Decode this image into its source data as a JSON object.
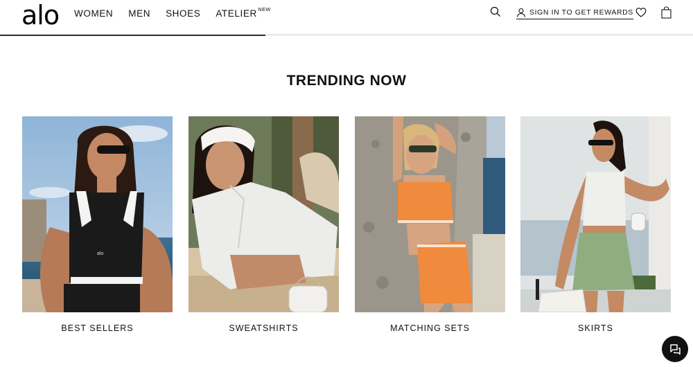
{
  "header": {
    "logo": "alo",
    "nav": [
      {
        "label": "WOMEN"
      },
      {
        "label": "MEN"
      },
      {
        "label": "SHOES"
      },
      {
        "label": "ATELIER",
        "badge": "NEW"
      }
    ],
    "signin_label": "SIGN IN TO GET REWARDS",
    "icons": [
      "search-icon",
      "user-icon",
      "heart-icon",
      "bag-icon"
    ]
  },
  "section": {
    "title": "TRENDING NOW",
    "cards": [
      {
        "label": "BEST SELLERS",
        "image": "woman in black and white sports tank and sunglasses by the sea"
      },
      {
        "label": "SWEATSHIRTS",
        "image": "woman in white headband and white zip pullover holding white bag"
      },
      {
        "label": "MATCHING SETS",
        "image": "woman in orange sports bra and orange shorts against rock wall"
      },
      {
        "label": "SKIRTS",
        "image": "woman in white tank and sage green skirt with tennis bag"
      }
    ]
  },
  "chat": {
    "icon": "chat-icon"
  },
  "colors": {
    "text": "#111111",
    "background": "#ffffff",
    "accent": "#000000"
  }
}
